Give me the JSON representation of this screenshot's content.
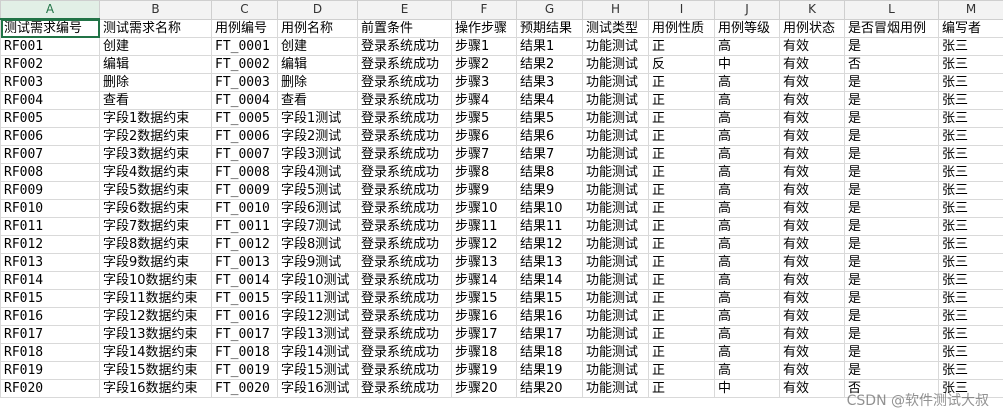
{
  "columns": [
    "A",
    "B",
    "C",
    "D",
    "E",
    "F",
    "G",
    "H",
    "I",
    "J",
    "K",
    "L",
    "M"
  ],
  "headers": [
    "测试需求编号",
    "测试需求名称",
    "用例编号",
    "用例名称",
    "前置条件",
    "操作步骤",
    "预期结果",
    "测试类型",
    "用例性质",
    "用例等级",
    "用例状态",
    "是否冒烟用例",
    "编写者"
  ],
  "rows": [
    [
      "RF001",
      "创建",
      "FT_0001",
      "创建",
      "登录系统成功",
      "步骤1",
      "结果1",
      "功能测试",
      "正",
      "高",
      "有效",
      "是",
      "张三"
    ],
    [
      "RF002",
      "编辑",
      "FT_0002",
      "编辑",
      "登录系统成功",
      "步骤2",
      "结果2",
      "功能测试",
      "反",
      "中",
      "有效",
      "否",
      "张三"
    ],
    [
      "RF003",
      "删除",
      "FT_0003",
      "删除",
      "登录系统成功",
      "步骤3",
      "结果3",
      "功能测试",
      "正",
      "高",
      "有效",
      "是",
      "张三"
    ],
    [
      "RF004",
      "查看",
      "FT_0004",
      "查看",
      "登录系统成功",
      "步骤4",
      "结果4",
      "功能测试",
      "正",
      "高",
      "有效",
      "是",
      "张三"
    ],
    [
      "RF005",
      "字段1数据约束",
      "FT_0005",
      "字段1测试",
      "登录系统成功",
      "步骤5",
      "结果5",
      "功能测试",
      "正",
      "高",
      "有效",
      "是",
      "张三"
    ],
    [
      "RF006",
      "字段2数据约束",
      "FT_0006",
      "字段2测试",
      "登录系统成功",
      "步骤6",
      "结果6",
      "功能测试",
      "正",
      "高",
      "有效",
      "是",
      "张三"
    ],
    [
      "RF007",
      "字段3数据约束",
      "FT_0007",
      "字段3测试",
      "登录系统成功",
      "步骤7",
      "结果7",
      "功能测试",
      "正",
      "高",
      "有效",
      "是",
      "张三"
    ],
    [
      "RF008",
      "字段4数据约束",
      "FT_0008",
      "字段4测试",
      "登录系统成功",
      "步骤8",
      "结果8",
      "功能测试",
      "正",
      "高",
      "有效",
      "是",
      "张三"
    ],
    [
      "RF009",
      "字段5数据约束",
      "FT_0009",
      "字段5测试",
      "登录系统成功",
      "步骤9",
      "结果9",
      "功能测试",
      "正",
      "高",
      "有效",
      "是",
      "张三"
    ],
    [
      "RF010",
      "字段6数据约束",
      "FT_0010",
      "字段6测试",
      "登录系统成功",
      "步骤10",
      "结果10",
      "功能测试",
      "正",
      "高",
      "有效",
      "是",
      "张三"
    ],
    [
      "RF011",
      "字段7数据约束",
      "FT_0011",
      "字段7测试",
      "登录系统成功",
      "步骤11",
      "结果11",
      "功能测试",
      "正",
      "高",
      "有效",
      "是",
      "张三"
    ],
    [
      "RF012",
      "字段8数据约束",
      "FT_0012",
      "字段8测试",
      "登录系统成功",
      "步骤12",
      "结果12",
      "功能测试",
      "正",
      "高",
      "有效",
      "是",
      "张三"
    ],
    [
      "RF013",
      "字段9数据约束",
      "FT_0013",
      "字段9测试",
      "登录系统成功",
      "步骤13",
      "结果13",
      "功能测试",
      "正",
      "高",
      "有效",
      "是",
      "张三"
    ],
    [
      "RF014",
      "字段10数据约束",
      "FT_0014",
      "字段10测试",
      "登录系统成功",
      "步骤14",
      "结果14",
      "功能测试",
      "正",
      "高",
      "有效",
      "是",
      "张三"
    ],
    [
      "RF015",
      "字段11数据约束",
      "FT_0015",
      "字段11测试",
      "登录系统成功",
      "步骤15",
      "结果15",
      "功能测试",
      "正",
      "高",
      "有效",
      "是",
      "张三"
    ],
    [
      "RF016",
      "字段12数据约束",
      "FT_0016",
      "字段12测试",
      "登录系统成功",
      "步骤16",
      "结果16",
      "功能测试",
      "正",
      "高",
      "有效",
      "是",
      "张三"
    ],
    [
      "RF017",
      "字段13数据约束",
      "FT_0017",
      "字段13测试",
      "登录系统成功",
      "步骤17",
      "结果17",
      "功能测试",
      "正",
      "高",
      "有效",
      "是",
      "张三"
    ],
    [
      "RF018",
      "字段14数据约束",
      "FT_0018",
      "字段14测试",
      "登录系统成功",
      "步骤18",
      "结果18",
      "功能测试",
      "正",
      "高",
      "有效",
      "是",
      "张三"
    ],
    [
      "RF019",
      "字段15数据约束",
      "FT_0019",
      "字段15测试",
      "登录系统成功",
      "步骤19",
      "结果19",
      "功能测试",
      "正",
      "高",
      "有效",
      "是",
      "张三"
    ],
    [
      "RF020",
      "字段16数据约束",
      "FT_0020",
      "字段16测试",
      "登录系统成功",
      "步骤20",
      "结果20",
      "功能测试",
      "正",
      "中",
      "有效",
      "否",
      "张三"
    ]
  ],
  "watermark": "CSDN @软件测试大叔"
}
